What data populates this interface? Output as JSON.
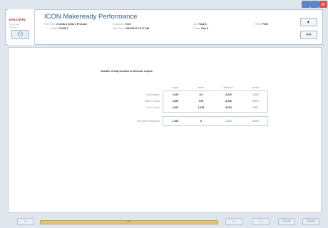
{
  "window": {
    "close_glyph": "×"
  },
  "logo": {
    "brand": "BALDWIN",
    "sub1": "Press Tech",
    "sub2": "Services"
  },
  "header": {
    "title": "ICON Makeready Performance",
    "fields": [
      {
        "label": "Print Run:",
        "value": "2 Units 4 Units 3 Presses"
      },
      {
        "label": "Date:",
        "value": "7/1/2017"
      },
      {
        "label": "Customer:",
        "value": "Tech"
      },
      {
        "label": "Start Time:",
        "value": "6/12/2017 12:17 AM"
      },
      {
        "label": "Job:",
        "value": "Task 6"
      },
      {
        "label": "Press:",
        "value": "Run 8"
      },
      {
        "label": "Print:",
        "value": "P100"
      }
    ]
  },
  "toolbar": {
    "btn1_icon": "toggle-icon",
    "btn2_icon": "binoculars-icon"
  },
  "report": {
    "section_title": "Number of Impressions to Genuine Copies",
    "columns": [
      "target",
      "actual",
      "difference",
      "percent"
    ],
    "rows": [
      {
        "label": "Color Register",
        "target": "3,025",
        "actual": "8.0",
        "difference": "-3,204",
        "percent": "-100%",
        "pct_color": "green"
      },
      {
        "label": "Ribbon Control",
        "target": "3,005",
        "actual": "2.00",
        "difference": "-3,206",
        "percent": "-100%",
        "pct_color": "green"
      },
      {
        "label": "Color Control",
        "target": "2,000",
        "actual": "1,025",
        "difference": "-3,204",
        "percent": "-50%",
        "pct_color": "red"
      }
    ],
    "total": {
      "label": "Plus preset impression",
      "target": "1,000",
      "actual": "8",
      "difference": "-1,000",
      "percent": "-100%"
    }
  },
  "footer": {
    "progress_label": "1/1",
    "progress_fraction": 0.72,
    "nav": [
      "‹‹",
      "››",
      "▭",
      "Prev",
      "Next"
    ]
  },
  "colors": {
    "accent": "#3a5a84",
    "brand": "#c0272d",
    "progress": "#e3c27f",
    "positive": "#3c9a3c",
    "negative": "#d23a3a"
  }
}
